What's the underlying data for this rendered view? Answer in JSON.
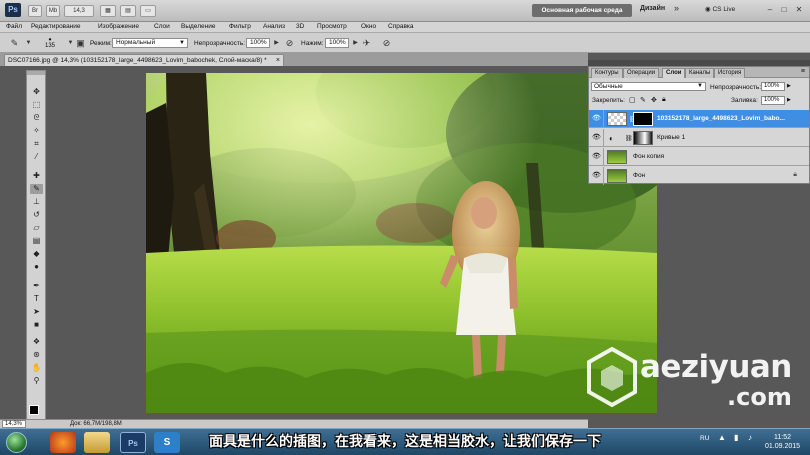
{
  "app": {
    "logo": "Ps",
    "zoom_dropdown": "14,3",
    "workspace_button": "Основная рабочая среда",
    "design_label": "Дизайн",
    "more_label": "»",
    "cslive_label": "CS Live"
  },
  "menu": [
    "Файл",
    "Редактирование",
    "Изображение",
    "Слои",
    "Выделение",
    "Фильтр",
    "Анализ",
    "3D",
    "Просмотр",
    "Окно",
    "Справка"
  ],
  "options": {
    "brush_size": "135",
    "mode_label": "Режим:",
    "mode_value": "Нормальный",
    "opacity_label": "Непрозрачность:",
    "opacity_value": "100%",
    "flow_label": "Нажим:",
    "flow_value": "100%"
  },
  "document": {
    "tab_title": "DSC07166.jpg @ 14,3% (103152178_large_4498623_Lovim_babochek, Слой-маска/8) *",
    "close": "×"
  },
  "status": {
    "zoom": "14,3%",
    "doc_info": "Док: 66,7M/198,8M"
  },
  "layers_panel": {
    "tabs": [
      "Контуры",
      "Операции",
      "Слои",
      "Каналы",
      "История"
    ],
    "active_tab": "Слои",
    "blend_mode": "Обычные",
    "opacity_label": "Непрозрачность:",
    "opacity_value": "100%",
    "lock_label": "Закрепить:",
    "fill_label": "Заливка:",
    "fill_value": "100%",
    "layers": [
      {
        "name": "103152178_large_4498623_Lovim_babo...",
        "selected": true
      },
      {
        "name": "Кривые 1",
        "selected": false
      },
      {
        "name": "Фон копия",
        "selected": false
      },
      {
        "name": "Фон",
        "selected": false
      }
    ]
  },
  "watermark": {
    "line1": "aeziyuan",
    "line2": ".com"
  },
  "taskbar": {
    "language": "RU",
    "time": "11:52",
    "date": "01.09.2015"
  },
  "subtitle": "面具是什么的插图，在我看来，这是相当胶水，让我们保存一下",
  "colors": {
    "selection_blue": "#3e8ee5",
    "taskbar": "#2b5878",
    "panel_bg": "#d6d6d6"
  }
}
